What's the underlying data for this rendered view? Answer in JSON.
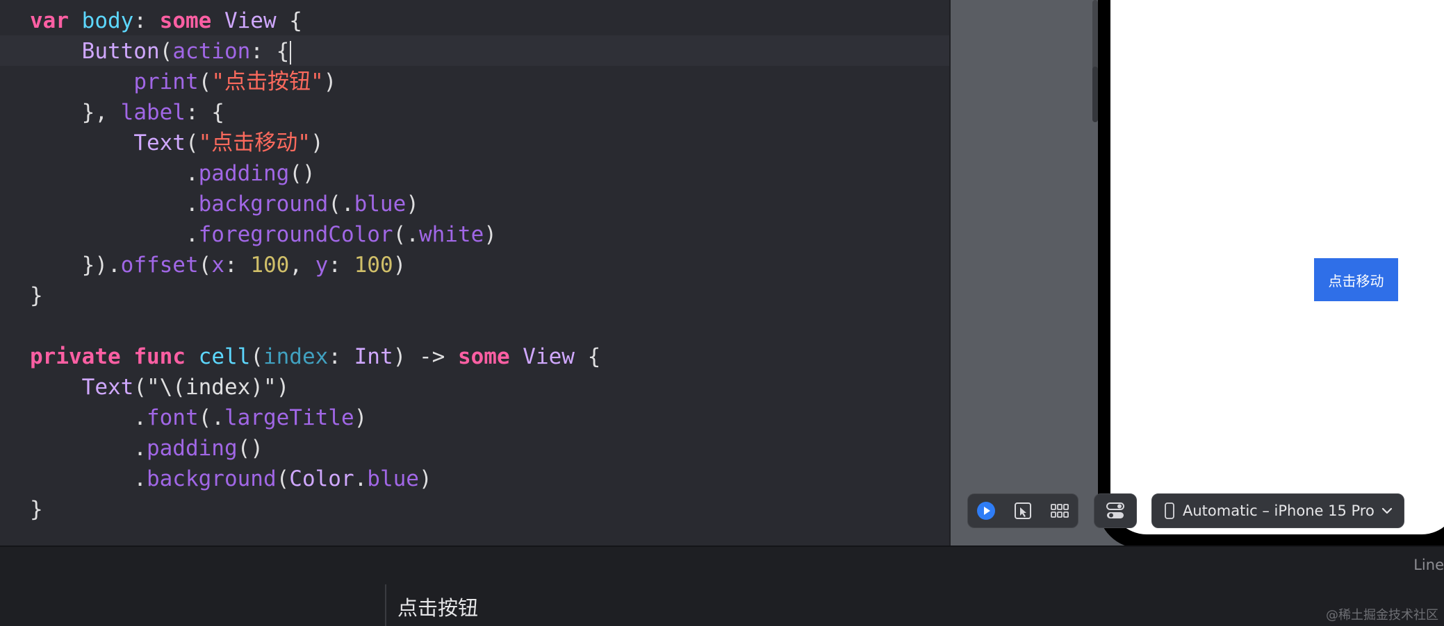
{
  "code_lines": [
    [
      [
        "kw",
        "var"
      ],
      [
        "plain",
        " "
      ],
      [
        "decl",
        "body"
      ],
      [
        "plain",
        ": "
      ],
      [
        "kw",
        "some"
      ],
      [
        "plain",
        " "
      ],
      [
        "type",
        "View"
      ],
      [
        "plain",
        " {"
      ]
    ],
    [
      [
        "plain",
        "    "
      ],
      [
        "type",
        "Button"
      ],
      [
        "plain",
        "("
      ],
      [
        "param",
        "action"
      ],
      [
        "plain",
        ": {"
      ]
    ],
    [
      [
        "plain",
        "        "
      ],
      [
        "fn",
        "print"
      ],
      [
        "plain",
        "("
      ],
      [
        "str",
        "\"点击按钮\""
      ],
      [
        "plain",
        ")"
      ]
    ],
    [
      [
        "plain",
        "    }, "
      ],
      [
        "param",
        "label"
      ],
      [
        "plain",
        ": {"
      ]
    ],
    [
      [
        "plain",
        "        "
      ],
      [
        "type",
        "Text"
      ],
      [
        "plain",
        "("
      ],
      [
        "str",
        "\"点击移动\""
      ],
      [
        "plain",
        ")"
      ]
    ],
    [
      [
        "plain",
        "            ."
      ],
      [
        "fn",
        "padding"
      ],
      [
        "plain",
        "()"
      ]
    ],
    [
      [
        "plain",
        "            ."
      ],
      [
        "fn",
        "background"
      ],
      [
        "plain",
        "(."
      ],
      [
        "fn",
        "blue"
      ],
      [
        "plain",
        ")"
      ]
    ],
    [
      [
        "plain",
        "            ."
      ],
      [
        "fn",
        "foregroundColor"
      ],
      [
        "plain",
        "(."
      ],
      [
        "fn",
        "white"
      ],
      [
        "plain",
        ")"
      ]
    ],
    [
      [
        "plain",
        "    })."
      ],
      [
        "fn",
        "offset"
      ],
      [
        "plain",
        "("
      ],
      [
        "param",
        "x"
      ],
      [
        "plain",
        ": "
      ],
      [
        "num",
        "100"
      ],
      [
        "plain",
        ", "
      ],
      [
        "param",
        "y"
      ],
      [
        "plain",
        ": "
      ],
      [
        "num",
        "100"
      ],
      [
        "plain",
        ")"
      ]
    ],
    [
      [
        "plain",
        "}"
      ]
    ],
    [
      [
        "plain",
        ""
      ]
    ],
    [
      [
        "kw",
        "private"
      ],
      [
        "plain",
        " "
      ],
      [
        "kw",
        "func"
      ],
      [
        "plain",
        " "
      ],
      [
        "decl",
        "cell"
      ],
      [
        "plain",
        "("
      ],
      [
        "id",
        "index"
      ],
      [
        "plain",
        ": "
      ],
      [
        "type",
        "Int"
      ],
      [
        "plain",
        ") -> "
      ],
      [
        "kw",
        "some"
      ],
      [
        "plain",
        " "
      ],
      [
        "type",
        "View"
      ],
      [
        "plain",
        " {"
      ]
    ],
    [
      [
        "plain",
        "    "
      ],
      [
        "type",
        "Text"
      ],
      [
        "plain",
        "(\"\\("
      ],
      [
        "plain",
        "index"
      ],
      [
        "plain",
        ")\")"
      ]
    ],
    [
      [
        "plain",
        "        ."
      ],
      [
        "fn",
        "font"
      ],
      [
        "plain",
        "(."
      ],
      [
        "fn",
        "largeTitle"
      ],
      [
        "plain",
        ")"
      ]
    ],
    [
      [
        "plain",
        "        ."
      ],
      [
        "fn",
        "padding"
      ],
      [
        "plain",
        "()"
      ]
    ],
    [
      [
        "plain",
        "        ."
      ],
      [
        "fn",
        "background"
      ],
      [
        "plain",
        "("
      ],
      [
        "type",
        "Color"
      ],
      [
        "plain",
        "."
      ],
      [
        "fn",
        "blue"
      ],
      [
        "plain",
        ")"
      ]
    ],
    [
      [
        "plain",
        "}"
      ]
    ]
  ],
  "preview": {
    "button_label": "点击移动"
  },
  "canvas_toolbar": {
    "modes": [
      {
        "name": "live-mode",
        "icon": "play-icon",
        "active": true
      },
      {
        "name": "selectable-mode",
        "icon": "cursor-select-icon",
        "active": false
      },
      {
        "name": "variants-grid",
        "icon": "grid-icon",
        "active": false
      }
    ],
    "device_settings_icon": "toggles-icon",
    "device_picker_label": "Automatic – iPhone 15 Pro",
    "device_picker_icon": "iphone-icon"
  },
  "status_bar": {
    "line_label": "Line"
  },
  "console": {
    "output": "点击按钮"
  },
  "watermark": "@稀土掘金技术社区",
  "colors": {
    "editor_bg": "#292a30",
    "keyword": "#fc5fa3",
    "declaration": "#5dd8ff",
    "type": "#d0a8ff",
    "function": "#a167e6",
    "string": "#fc6a5d",
    "number": "#d0bf69",
    "accent_blue": "#2f6fe8"
  }
}
